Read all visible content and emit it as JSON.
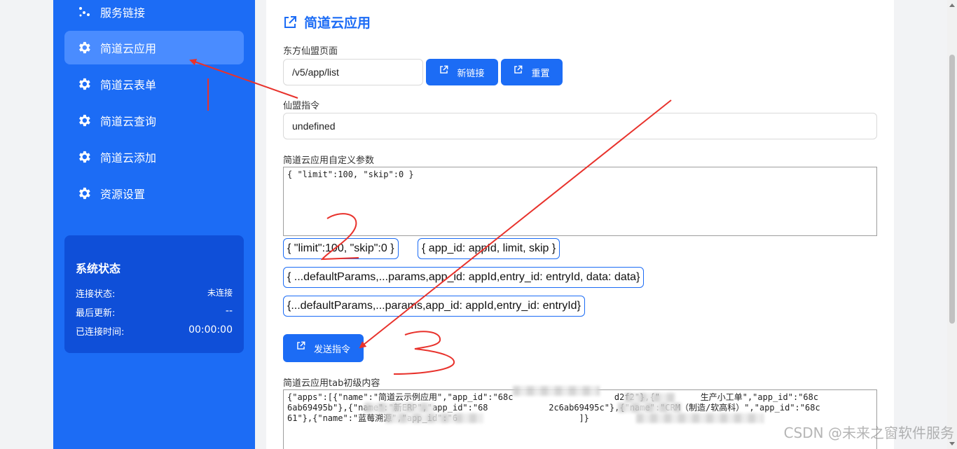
{
  "sidebar": {
    "items": [
      {
        "label": "服务链接",
        "icon": "dots-icon"
      },
      {
        "label": "简道云应用",
        "icon": "gear-icon",
        "active": true
      },
      {
        "label": "简道云表单",
        "icon": "gear-icon"
      },
      {
        "label": "简道云查询",
        "icon": "gear-icon"
      },
      {
        "label": "简道云添加",
        "icon": "gear-icon"
      },
      {
        "label": "资源设置",
        "icon": "gear-icon"
      }
    ],
    "status": {
      "title": "系统状态",
      "rows": [
        {
          "key": "连接状态:",
          "value": "未连接"
        },
        {
          "key": "最后更新:",
          "value": "--"
        },
        {
          "key": "已连接时间:",
          "value": "00:00:00"
        }
      ]
    }
  },
  "main": {
    "title": "简道云应用",
    "page_label": "东方仙盟页面",
    "page_input": "/v5/app/list",
    "new_link_button": "新链接",
    "reset_button": "重置",
    "command_label": "仙盟指令",
    "command_input": "undefined",
    "params_label": "简道云应用自定义参数",
    "params_text": "{ \"limit\":100, \"skip\":0 }",
    "chips": [
      "{ \"limit\":100, \"skip\":0 }",
      "{ app_id: appId, limit, skip }",
      "{ ...defaultParams,...params,app_id: appId,entry_id: entryId, data: data}",
      "{...defaultParams,...params,app_id: appId,entry_id: entryId}"
    ],
    "send_button": "发送指令",
    "result_label": "简道云应用tab初级内容",
    "result_text": "{\"apps\":[{\"name\":\"简道云示例应用\",\"app_id\":\"68c                    d2f2\"},{\"        生产小工单\",\"app_id\":\"68c             6ab69495b\"},{\"name\":\"新ERP\",\"app_id\":\"68            2c6ab69495c\"},{\"name\":\"CRM（制造/软高科）\",\"app_id\":\"68c                   61\"},{\"name\":\"蓝莓溯源\",\"app_id\":\"6                        ]}"
  },
  "watermark": "CSDN @未来之窗软件服务",
  "annotations": [
    "2",
    "3"
  ],
  "colors": {
    "accent": "#1c6cf5",
    "sidebar": "#1c6cf5",
    "active_item": "#4a8cff",
    "status_card": "#0f4fd8",
    "arrow": "#e8322c"
  }
}
